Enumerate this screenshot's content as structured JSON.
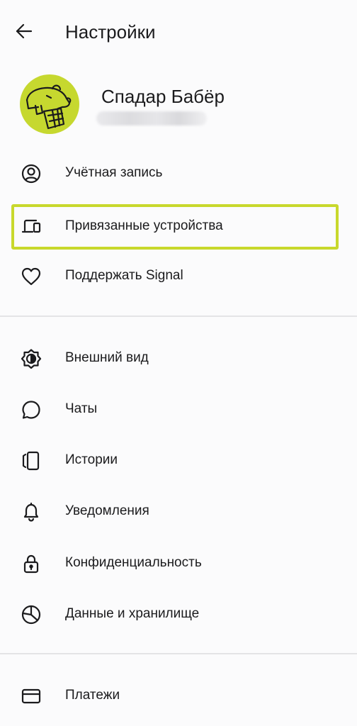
{
  "header": {
    "title": "Настройки"
  },
  "profile": {
    "name": "Спадар Бабёр"
  },
  "menu": {
    "account": "Учётная запись",
    "linked_devices": "Привязанные устройства",
    "donate": "Поддержать Signal",
    "appearance": "Внешний вид",
    "chats": "Чаты",
    "stories": "Истории",
    "notifications": "Уведомления",
    "privacy": "Конфиденциальность",
    "data_storage": "Данные и хранилище",
    "payments": "Платежи"
  },
  "colors": {
    "background": "#fbfbfc",
    "avatar": "#c6d82f",
    "highlight": "#c8d82c",
    "text": "#1b1b1d",
    "divider": "#e4e4e6"
  },
  "icons": {
    "back": "arrow-left-icon",
    "account": "person-circle-icon",
    "linked_devices": "devices-icon",
    "donate": "heart-icon",
    "appearance": "brightness-icon",
    "chats": "chat-bubble-icon",
    "stories": "stories-icon",
    "notifications": "bell-icon",
    "privacy": "lock-icon",
    "data_storage": "pie-chart-icon",
    "payments": "card-icon"
  }
}
